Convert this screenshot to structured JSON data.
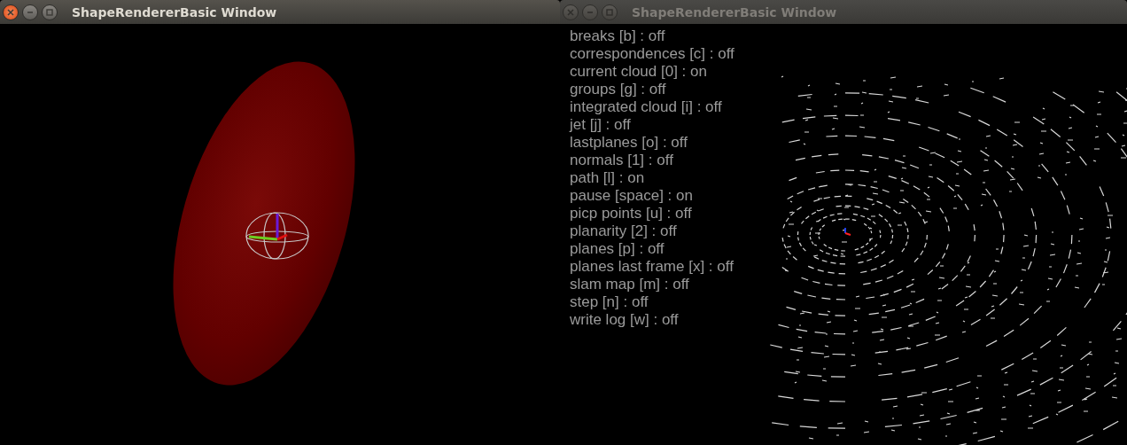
{
  "windows": [
    {
      "kind": "shape-view",
      "title": "ShapeRendererBasic Window",
      "active": true
    },
    {
      "kind": "cloud-view",
      "title": "ShapeRendererBasic Window",
      "active": false,
      "options": [
        "breaks [b] : off",
        "correspondences [c] : off",
        "current cloud [0] : on",
        "groups [g] : off",
        "integrated cloud [i] : off",
        "jet [j] : off",
        "lastplanes [o] : off",
        "normals [1] : off",
        "path [l] : on",
        "pause [space] : on",
        "picp points [u] : off",
        "planarity [2] : off",
        "planes [p] : off",
        "planes last frame [x] : off",
        "slam map [m] : off",
        "step [n] : off",
        "write log [w] : off"
      ]
    }
  ]
}
